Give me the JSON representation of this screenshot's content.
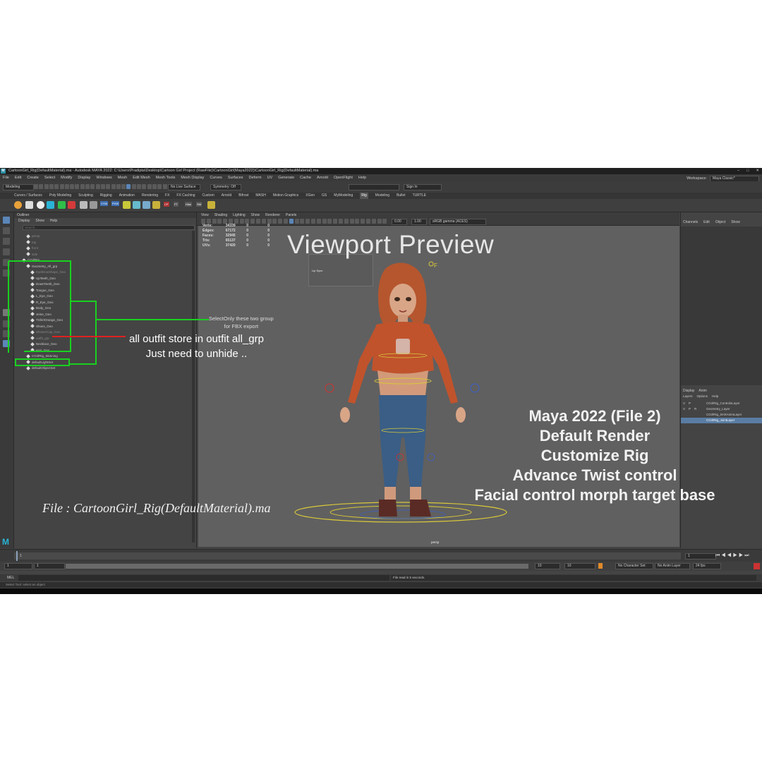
{
  "window": {
    "title": "CartoonGirl_Rig(DefaultMaterial).ma - Autodesk MAYA 2022: C:\\Users\\Pradipta\\Desktop\\Cartoon Girl Project (RawFile)\\CartoonGirl(Maya2022)\\CartoonGirl_Rig(DefaultMaterial).ma",
    "logo": "M",
    "controls": [
      "–",
      "□",
      "✕"
    ]
  },
  "menubar": {
    "items": [
      "File",
      "Edit",
      "Create",
      "Select",
      "Modify",
      "Display",
      "Windows",
      "Mesh",
      "Edit Mesh",
      "Mesh Tools",
      "Mesh Display",
      "Curves",
      "Surfaces",
      "Deform",
      "UV",
      "Generate",
      "Cache",
      "Arnold",
      "OpenFlight",
      "Help"
    ],
    "workspace_label": "Workspace:",
    "workspace_value": "Maya Classic*"
  },
  "statusline": {
    "mode": "Modeling",
    "live_surface": "No Live Surface",
    "symmetry": "Symmetry: Off",
    "sign_in": "Sign In"
  },
  "shelf": {
    "tabs": [
      "Curves / Surfaces",
      "Poly Modeling",
      "Sculpting",
      "Rigging",
      "Animation",
      "Rendering",
      "FX",
      "FX Caching",
      "Custom",
      "Arnold",
      "Bifrost",
      "MASH",
      "Motion Graphics",
      "XGen",
      "GS",
      "MyModeling",
      "Rig",
      "Modeling",
      "Bullet",
      "TURTLE"
    ],
    "active_tab": "Rig",
    "button_labels": [
      "CYW",
      "PVW",
      "CP",
      "FT",
      "Hike",
      "SW"
    ]
  },
  "outliner": {
    "title": "Outliner",
    "menu": [
      "Display",
      "Show",
      "Help"
    ],
    "search_placeholder": "Search...",
    "items": [
      {
        "label": "persp",
        "indent": 1,
        "state": "hidden"
      },
      {
        "label": "top",
        "indent": 1,
        "state": "hidden"
      },
      {
        "label": "front",
        "indent": 1,
        "state": "hidden"
      },
      {
        "label": "side",
        "indent": 1,
        "state": "hidden"
      },
      {
        "label": "CGirlRig",
        "indent": 0,
        "state": "normal"
      },
      {
        "label": "Geometry_All_grp",
        "indent": 1,
        "state": "normal"
      },
      {
        "label": "EyeBrowShape_Geo",
        "indent": 2,
        "state": "hidden"
      },
      {
        "label": "UpTeeth_Geo",
        "indent": 2,
        "state": "normal"
      },
      {
        "label": "DownTeeth_Geo",
        "indent": 2,
        "state": "normal"
      },
      {
        "label": "Tongue_Geo",
        "indent": 2,
        "state": "normal"
      },
      {
        "label": "L_Eye_Geo",
        "indent": 2,
        "state": "normal"
      },
      {
        "label": "R_Eye_Geo",
        "indent": 2,
        "state": "normal"
      },
      {
        "label": "Body_Geo",
        "indent": 2,
        "state": "normal"
      },
      {
        "label": "Jeine_Geo",
        "indent": 2,
        "state": "normal"
      },
      {
        "label": "TShirtOrange_Geo",
        "indent": 2,
        "state": "normal"
      },
      {
        "label": "Shoes_Geo",
        "indent": 2,
        "state": "normal"
      },
      {
        "label": "ShowerCap_Geo",
        "indent": 2,
        "state": "hidden"
      },
      {
        "label": "outfit_grp",
        "indent": 2,
        "state": "hidden"
      },
      {
        "label": "Necklace_Geo",
        "indent": 2,
        "state": "normal"
      },
      {
        "label": "Hair_Geo",
        "indent": 2,
        "state": "normal"
      },
      {
        "label": "CGirlRig_Skinning",
        "indent": 1,
        "state": "normal"
      },
      {
        "label": "defaultLightSet",
        "indent": 1,
        "state": "normal"
      },
      {
        "label": "defaultObjectSet",
        "indent": 1,
        "state": "normal"
      }
    ]
  },
  "viewport": {
    "menu": [
      "View",
      "Shading",
      "Lighting",
      "Show",
      "Renderer",
      "Panels"
    ],
    "exposure": "0.00",
    "gamma": "1.00",
    "colorspace": "sRGB gamma (ACES)",
    "hud": [
      {
        "label": "Verts:",
        "value": "34339",
        "a": "0",
        "b": "0"
      },
      {
        "label": "Edges:",
        "value": "67172",
        "a": "0",
        "b": "0"
      },
      {
        "label": "Faces:",
        "value": "32945",
        "a": "0",
        "b": "0"
      },
      {
        "label": "Tris:",
        "value": "65137",
        "a": "0",
        "b": "0"
      },
      {
        "label": "UVs:",
        "value": "37420",
        "a": "0",
        "b": "0"
      }
    ],
    "camera_label": "persp",
    "facial_label": "Lip Sync"
  },
  "channelbox": {
    "menu": [
      "Channels",
      "Edit",
      "Object",
      "Show"
    ]
  },
  "layers": {
    "tabs": [
      "Display",
      "Anim"
    ],
    "menu": [
      "Layers",
      "Options",
      "Help"
    ],
    "rows": [
      {
        "v": "V",
        "p": "P",
        "r": "",
        "name": "CGirlRig_ControlsLayer",
        "selected": false
      },
      {
        "v": "V",
        "p": "P",
        "r": "R",
        "name": "Geometry_Layer",
        "selected": false
      },
      {
        "v": "",
        "p": "",
        "r": "",
        "name": "CGirlRig_SHXAnimLayer",
        "selected": false
      },
      {
        "v": "",
        "p": "",
        "r": "",
        "name": "CGirlRig_JointLayer",
        "selected": true
      }
    ]
  },
  "timeline": {
    "current_frame": "1",
    "range_start": "1",
    "range_inner_start": "1",
    "range_inner_end": "10",
    "range_end": "10",
    "range_end2": "10",
    "character_set": "No Character Set",
    "anim_layer": "No Anim Layer",
    "fps": "24 fps"
  },
  "cmdline": {
    "label": "MEL",
    "result": "File read in  5 seconds."
  },
  "helpline": "Select Tool: select an object",
  "overlays": {
    "viewport_title": "Viewport Preview",
    "features": [
      "Maya 2022 (File 2)",
      "Default Render",
      "Customize Rig",
      "Advance Twist control",
      "Facial control morph target base"
    ],
    "file_label": "File : CartoonGirl_Rig(DefaultMaterial).ma",
    "annot_red": [
      "all outfit store in outfit all_grp",
      "Just need to unhide .."
    ],
    "annot_green": [
      "SelectOnly these two group",
      "for FBX export"
    ]
  },
  "colors": {
    "annotation_green": "#19d11f",
    "annotation_red": "#e02020",
    "selection_blue": "#5a7da4"
  }
}
